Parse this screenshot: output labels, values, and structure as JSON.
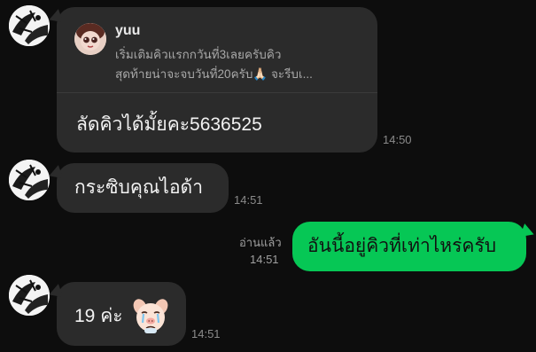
{
  "conversation": {
    "messages": [
      {
        "reply_to": {
          "name": "yuu",
          "line1": "เริ่มเติมคิวแรกกวันที่3เลยครับคิว",
          "line2_text": "สุดท้ายน่าจะจบวันที่20ครับ",
          "line2_emoji": "🙏🏻",
          "line2_tail": "จะรีบเ..."
        },
        "text": "ลัดคิวได้มั้ยคะ5636525",
        "time": "14:50"
      },
      {
        "text": "กระซิบคุณไอด้า",
        "time": "14:51"
      },
      {
        "read_label": "อ่านแล้ว",
        "text": "อันนี้อยู่คิวที่เท่าไหร่ครับ",
        "time": "14:51"
      },
      {
        "text": "19 ค่ะ",
        "time": "14:51"
      }
    ]
  },
  "colors": {
    "background": "#0d0d0d",
    "incoming_bubble": "#2b2b2b",
    "outgoing_bubble": "#06c755",
    "timestamp": "#8a8a8a"
  },
  "icons": {
    "contact_avatar": "sketch-avatar",
    "reply_avatar": "doll-avatar",
    "sticker": "crying-pig-sticker"
  }
}
